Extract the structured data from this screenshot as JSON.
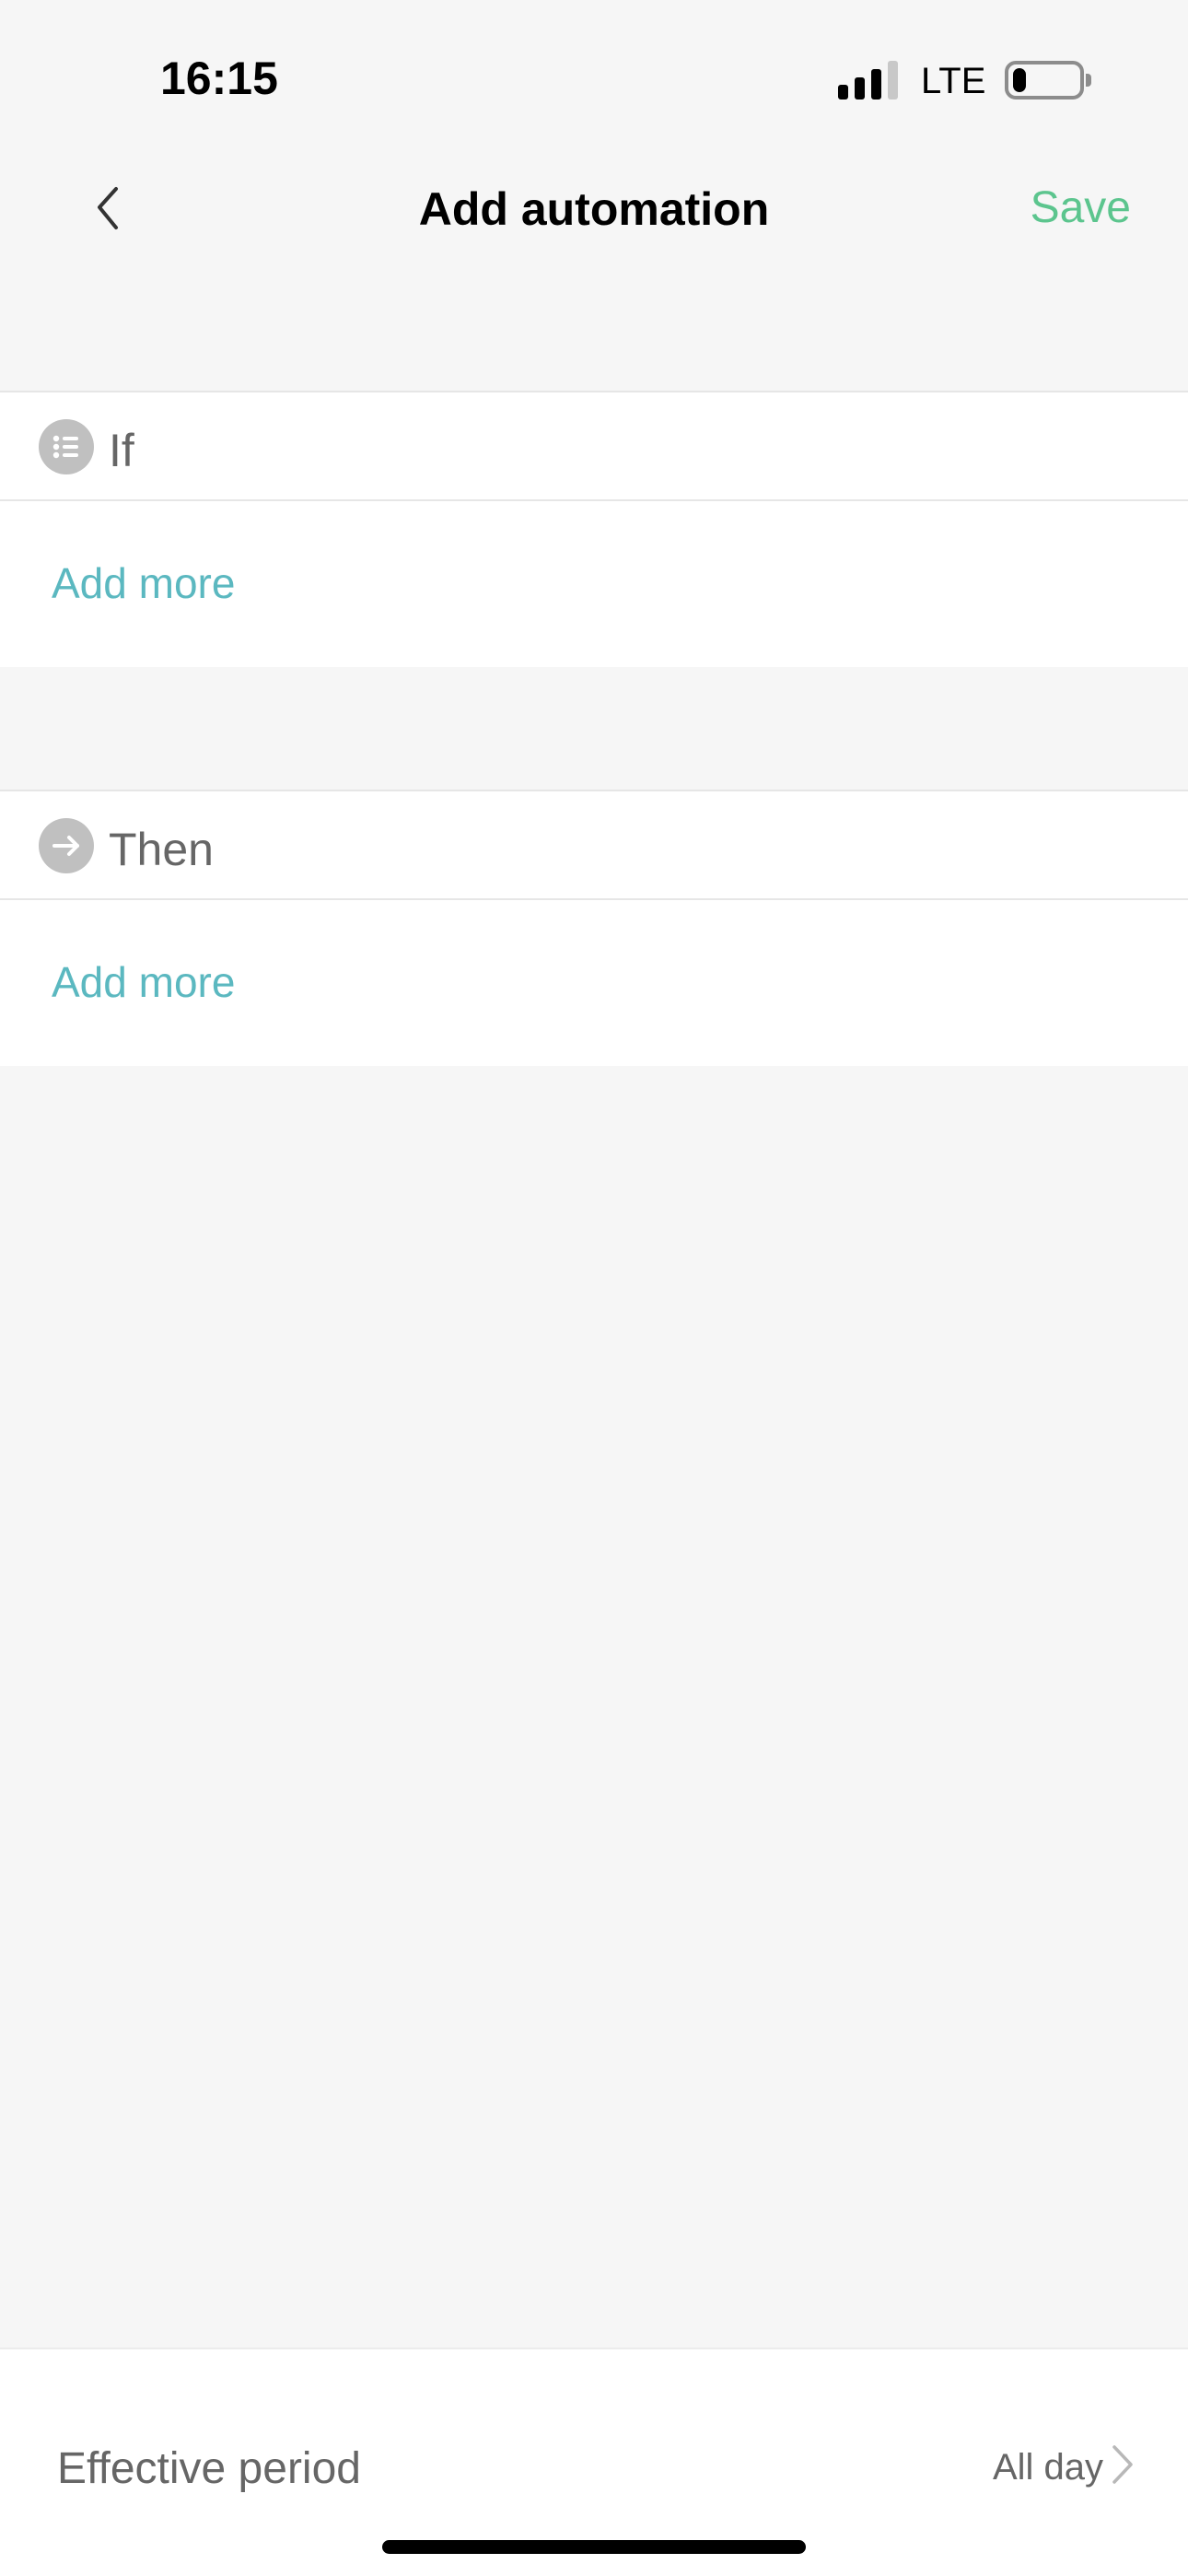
{
  "status_bar": {
    "time": "16:15",
    "network": "LTE",
    "signal_bars_active": 3,
    "signal_bars_total": 4,
    "battery_level_percent": 15
  },
  "nav": {
    "title": "Add automation",
    "save_label": "Save",
    "back_icon": "chevron-left-icon"
  },
  "sections": {
    "if": {
      "label": "If",
      "icon": "list-icon",
      "add_more_label": "Add more"
    },
    "then": {
      "label": "Then",
      "icon": "arrow-right-icon",
      "add_more_label": "Add more"
    }
  },
  "effective_period": {
    "label": "Effective period",
    "value": "All day",
    "chevron_icon": "chevron-right-icon"
  },
  "colors": {
    "save": "#5cc58e",
    "add_more": "#5bb8c0",
    "icon_bg": "#c0c0c0",
    "background": "#f6f6f6"
  }
}
